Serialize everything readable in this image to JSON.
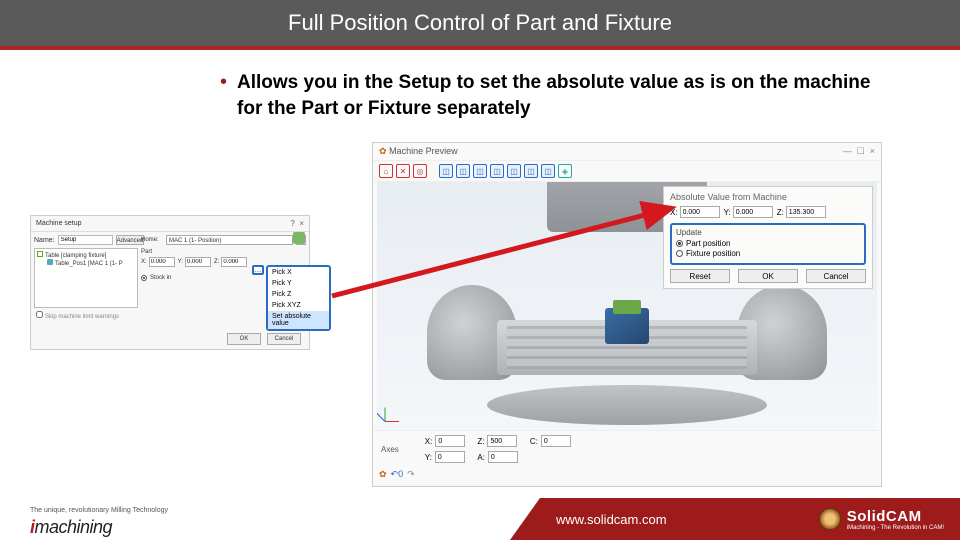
{
  "header": {
    "title": "Full Position Control of Part and Fixture"
  },
  "bullet": {
    "text": "Allows you in the Setup to set the absolute value as is on the machine for the Part or Fixture separately"
  },
  "setup": {
    "title": "Machine setup",
    "name_lbl": "Name:",
    "name_val": "Setup",
    "advanced": "Advanced",
    "tree_line1": "Table [clamping fixture]",
    "tree_line2": "Table_Pos1 [MAC 1 (1- P",
    "home_lbl": "Home:",
    "home_val": "MAC 1 (1- Position)",
    "part_lbl": "Part",
    "x_lbl": "X:",
    "x_val": "0.000",
    "y_lbl": "Y:",
    "y_val": "0.000",
    "z_lbl": "Z:",
    "z_val": "0.000",
    "stock_lbl": "Stock in",
    "skip": "Skip machine limit warnings",
    "ok": "OK",
    "cancel": "Cancel",
    "menu": {
      "pickx": "Pick X",
      "picky": "Pick Y",
      "pickz": "Pick Z",
      "pickxyz": "Pick XYZ",
      "setabs": "Set absolute value"
    }
  },
  "preview": {
    "title": "Machine Preview",
    "abs": {
      "title": "Absolute Value from Machine",
      "x_lbl": "X:",
      "x_val": "0.000",
      "y_lbl": "Y:",
      "y_val": "0.000",
      "z_lbl": "Z:",
      "z_val": "135.300",
      "update": "Update",
      "part_pos": "Part position",
      "fix_pos": "Fixture position",
      "reset": "Reset",
      "ok": "OK",
      "cancel": "Cancel"
    },
    "axes": {
      "label": "Axes",
      "x_lbl": "X:",
      "x_val": "0",
      "y_lbl": "Y:",
      "y_val": "0",
      "z_lbl": "Z:",
      "z_val": "500",
      "a_lbl": "A:",
      "a_val": "0",
      "c_lbl": "C:",
      "c_val": "0"
    }
  },
  "footer": {
    "im_tag": "The unique, revolutionary Milling Technology",
    "url": "www.solidcam.com",
    "sc_name": "SolidCAM",
    "sc_tag": "iMachining - The Revolution in CAM!"
  }
}
